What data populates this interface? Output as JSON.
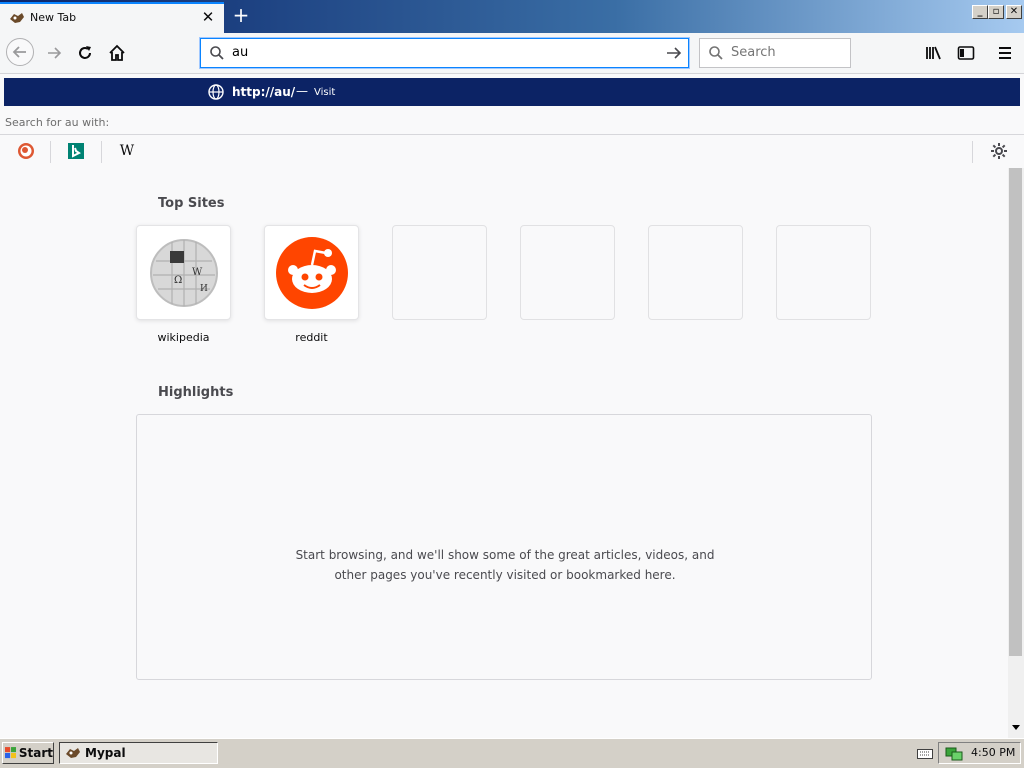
{
  "tab": {
    "title": "New Tab"
  },
  "navbar": {
    "url_value": "au",
    "search_placeholder": "Search"
  },
  "dropdown": {
    "visit_url": "http://au/",
    "visit_dash": "—",
    "visit_label": "Visit",
    "search_for_text": "Search for au with:",
    "engines": [
      "DuckDuckGo",
      "Bing",
      "Wikipedia"
    ],
    "engines_glyph_wikipedia": "W"
  },
  "content": {
    "top_sites_title": "Top Sites",
    "top_sites": [
      {
        "label": "wikipedia",
        "icon": "wikipedia-globe-icon"
      },
      {
        "label": "reddit",
        "icon": "reddit-icon"
      }
    ],
    "highlights_title": "Highlights",
    "highlights_empty_message": "Start browsing, and we'll show some of the great articles, videos, and other pages you've recently visited or bookmarked here."
  },
  "taskbar": {
    "start_label": "Start",
    "task_label": "Mypal",
    "clock": "4:50 PM"
  },
  "colors": {
    "accent": "#0a84ff",
    "dropdown_selected": "#0c2365",
    "reddit": "#ff4500"
  }
}
